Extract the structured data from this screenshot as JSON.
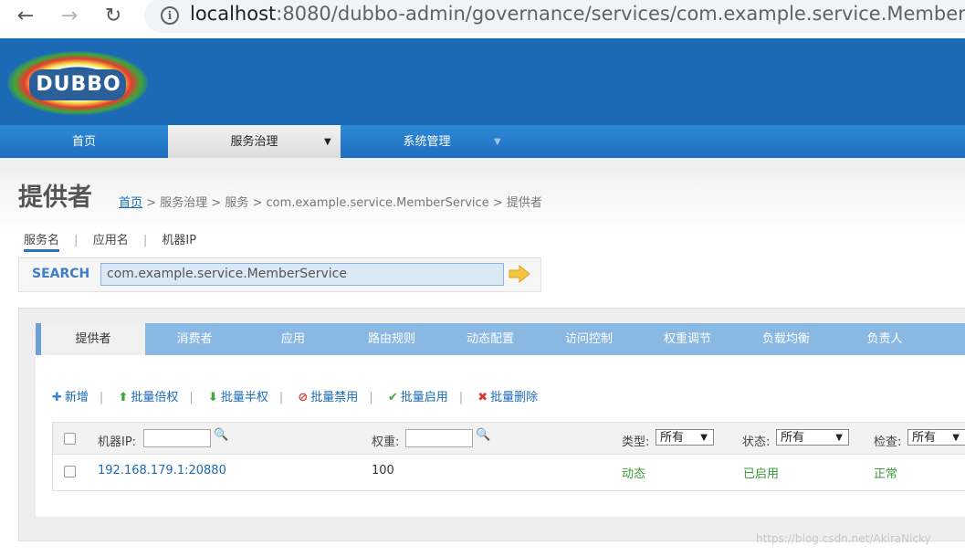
{
  "browser": {
    "back_icon": "←",
    "forward_icon": "→",
    "reload_icon": "↻",
    "info_icon": "i",
    "url_host": "localhost",
    "url_rest": ":8080/dubbo-admin/governance/services/com.example.service.MemberSer"
  },
  "logo": {
    "text": "DUBBO"
  },
  "nav": {
    "items": [
      {
        "label": "首页"
      },
      {
        "label": "服务治理",
        "arrow": "▼"
      },
      {
        "label": "系统管理",
        "arrow": "▼"
      }
    ]
  },
  "page": {
    "title": "提供者",
    "breadcrumb": {
      "home": "首页",
      "rest": " > 服务治理 > 服务 > com.example.service.MemberService > 提供者"
    }
  },
  "search": {
    "tabs": [
      "服务名",
      "应用名",
      "机器IP"
    ],
    "separator": "|",
    "label": "SEARCH",
    "value": "com.example.service.MemberService"
  },
  "tabs": [
    "提供者",
    "消费者",
    "应用",
    "路由规则",
    "动态配置",
    "访问控制",
    "权重调节",
    "负载均衡",
    "负责人"
  ],
  "toolbar": {
    "items": [
      {
        "icon": "✚",
        "label": "新增"
      },
      {
        "icon": "⬆",
        "label": "批量倍权"
      },
      {
        "icon": "⬇",
        "label": "批量半权"
      },
      {
        "icon": "⊘",
        "label": "批量禁用"
      },
      {
        "icon": "✔",
        "label": "批量启用"
      },
      {
        "icon": "✖",
        "label": "批量删除"
      }
    ],
    "separator": "|"
  },
  "table": {
    "headers": {
      "ip": "机器IP:",
      "weight": "权重:",
      "type": "类型:",
      "status": "状态:",
      "check": "检查:"
    },
    "filters": {
      "search_icon": "🔍",
      "type_value": "所有",
      "status_value": "所有",
      "check_value": "所有",
      "caret": "▼"
    },
    "rows": [
      {
        "address": "192.168.179.1:20880",
        "weight": "100",
        "type": "动态",
        "status": "已启用",
        "check": "正常"
      }
    ]
  },
  "watermark": "https://blog.csdn.net/AkiraNicky"
}
